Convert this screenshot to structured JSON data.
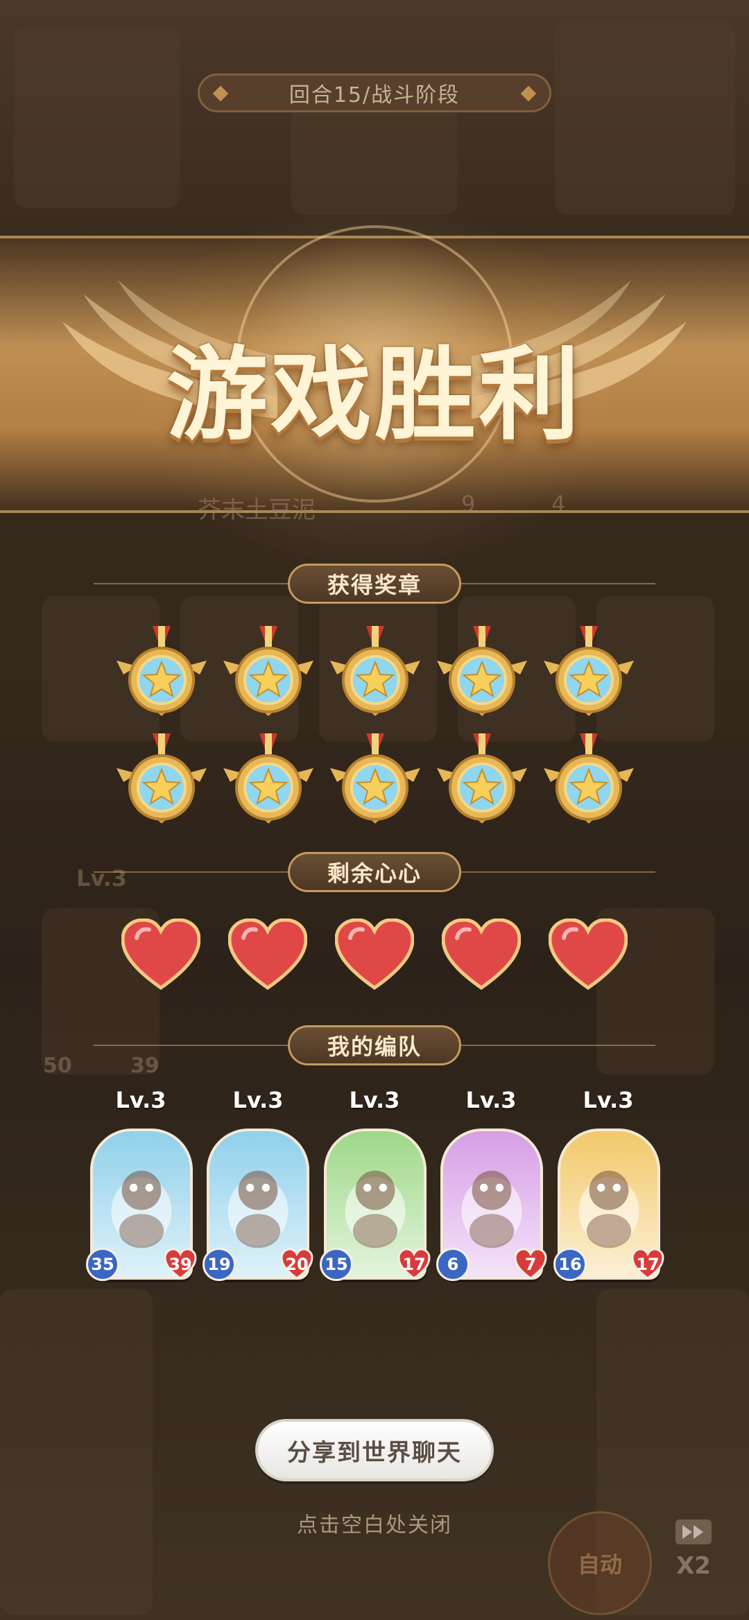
{
  "top_bar": {
    "round_status": "回合15/战斗阶段"
  },
  "banner": {
    "title": "游戏胜利",
    "player_name": "芥末土豆泥",
    "player_wins": "9",
    "player_hearts": "4"
  },
  "medals_section": {
    "label": "获得奖章",
    "count": 10
  },
  "hearts_section": {
    "label": "剩余心心",
    "count": 5
  },
  "team_section": {
    "label": "我的编队",
    "members": [
      {
        "level": "Lv.3",
        "attack": "35",
        "health": "39",
        "color": "#8fd0ea",
        "creature_icon": "raccoon-creature-icon"
      },
      {
        "level": "Lv.3",
        "attack": "19",
        "health": "20",
        "color": "#8fd0ea",
        "creature_icon": "axolotl-creature-icon"
      },
      {
        "level": "Lv.3",
        "attack": "15",
        "health": "17",
        "color": "#9ed888",
        "creature_icon": "drum-creature-icon"
      },
      {
        "level": "Lv.3",
        "attack": "6",
        "health": "7",
        "color": "#d79ee6",
        "creature_icon": "mushroom-fairy-icon"
      },
      {
        "level": "Lv.3",
        "attack": "16",
        "health": "17",
        "color": "#f2c96a",
        "creature_icon": "fox-spirit-icon"
      }
    ]
  },
  "background_ghost": {
    "level": "Lv.3",
    "attack": "50",
    "health": "39"
  },
  "actions": {
    "share_label": "分享到世界聊天",
    "close_hint": "点击空白处关闭",
    "auto_label": "自动",
    "speed_label": "X2"
  },
  "colors": {
    "accent_gold": "#c69a5e",
    "heart_red": "#e04848",
    "attack_blue": "#3a66c4"
  }
}
